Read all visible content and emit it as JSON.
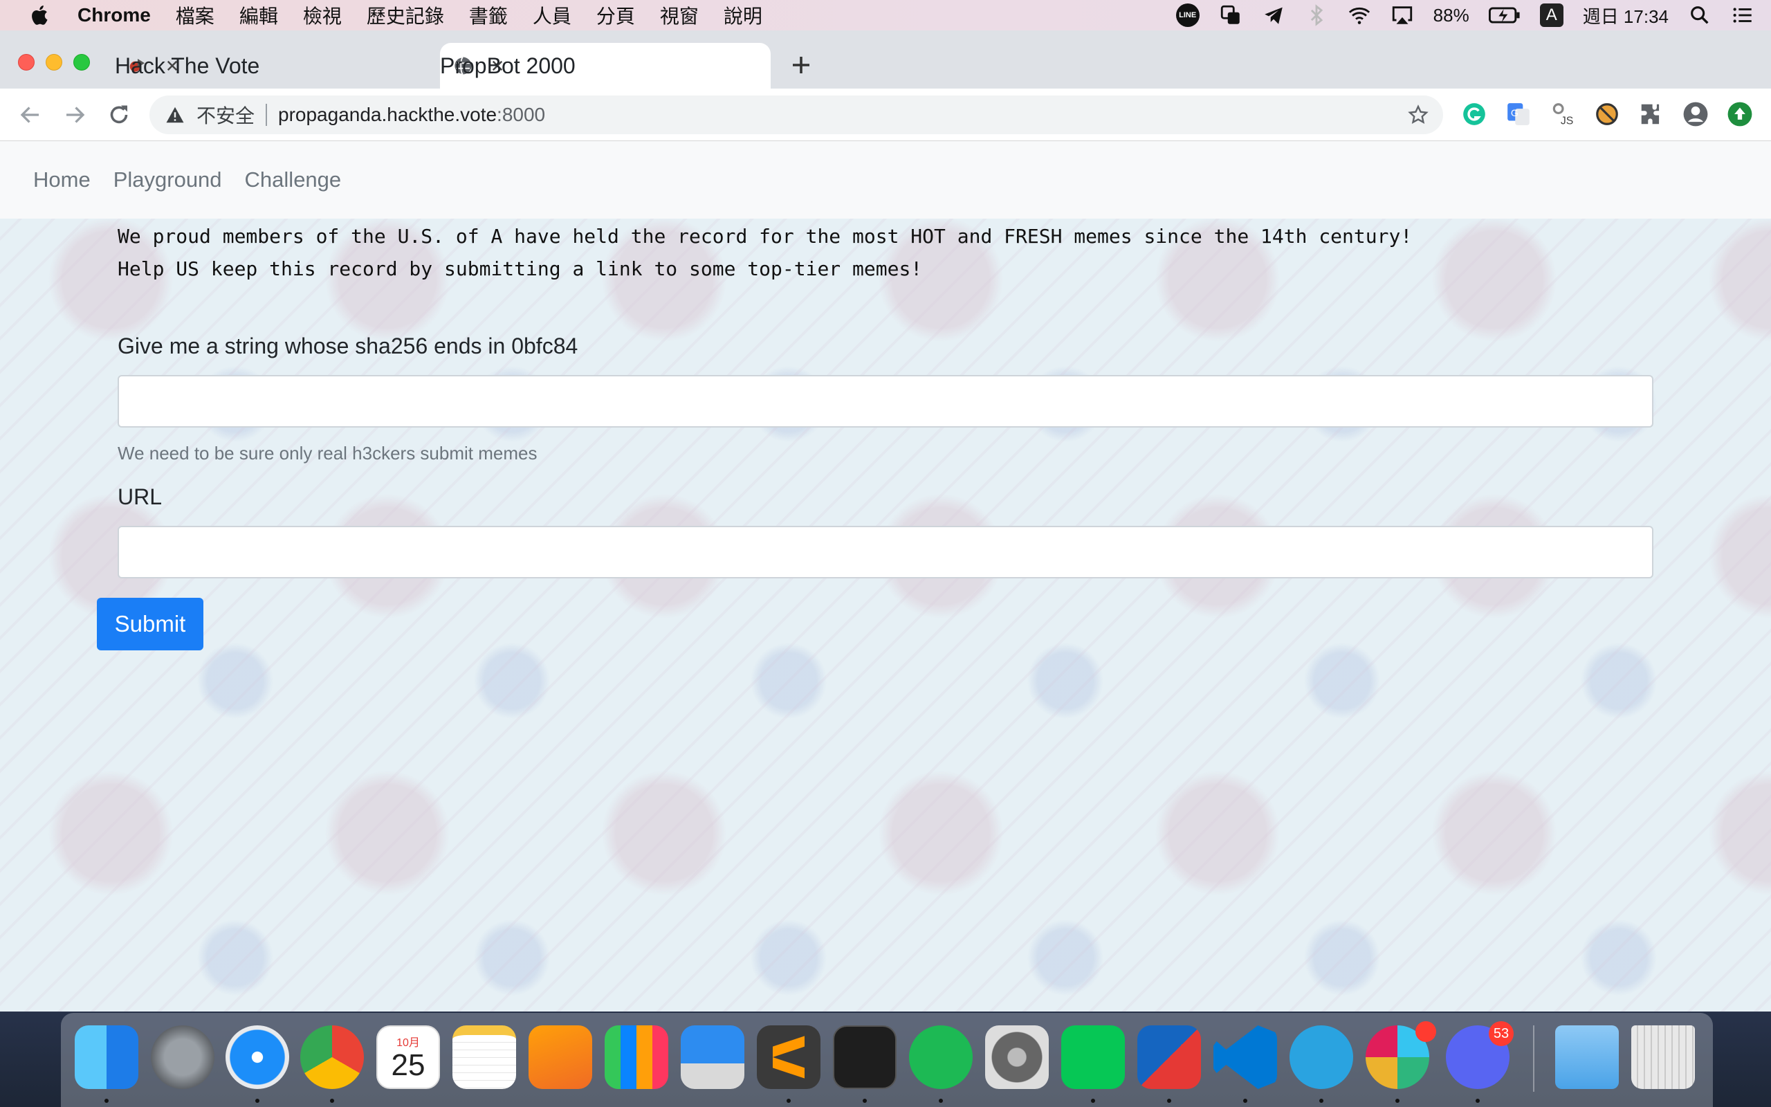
{
  "menubar": {
    "app_name": "Chrome",
    "menus": [
      "檔案",
      "編輯",
      "檢視",
      "歷史記錄",
      "書籤",
      "人員",
      "分頁",
      "視窗",
      "說明"
    ],
    "line_icon_text": "LINE",
    "battery": "88%",
    "input_source": "A",
    "clock": "週日 17:34"
  },
  "browser": {
    "tabs": [
      {
        "title": "Hack The Vote",
        "active": false
      },
      {
        "title": "PropBot 2000",
        "active": true
      }
    ],
    "security_label": "不安全",
    "url_host": "propaganda.hackthe.vote",
    "url_port": ":8000"
  },
  "navbar": {
    "links": [
      "Home",
      "Playground",
      "Challenge"
    ]
  },
  "main": {
    "intro_line1": "We proud members of the U.S. of A have held the record for the most HOT and FRESH memes since the 14th century!",
    "intro_line2": "Help US keep this record by submitting a link to some top-tier memes!",
    "pow_label": "Give me a string whose sha256 ends in 0bfc84",
    "pow_value": "",
    "pow_help": "We need to be sure only real h3ckers submit memes",
    "url_label": "URL",
    "url_value": "",
    "submit_label": "Submit"
  },
  "dock": {
    "calendar_month": "10月",
    "calendar_day": "25",
    "discord_badge": "53"
  },
  "colors": {
    "accent": "#1a7ef6",
    "page_bg": "#e6f0f5",
    "navbar_bg": "#f8f9fa"
  }
}
